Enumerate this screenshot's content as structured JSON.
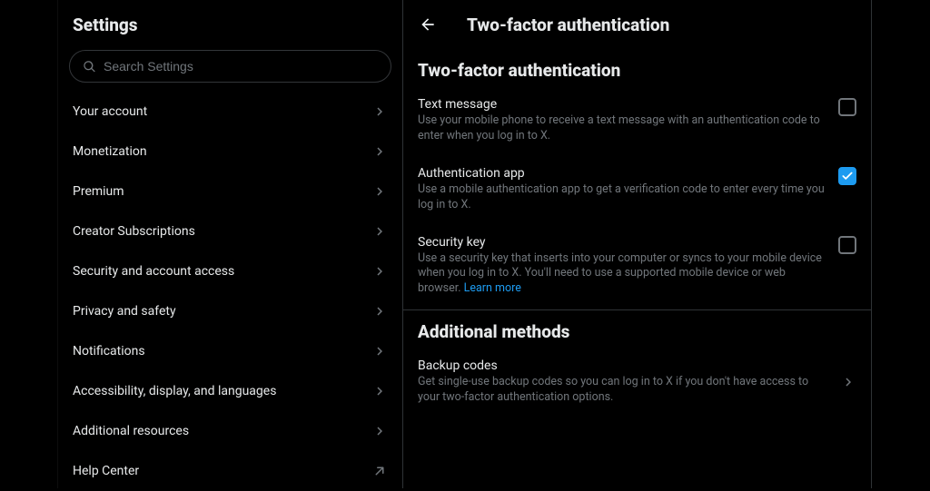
{
  "settings": {
    "title": "Settings",
    "search_placeholder": "Search Settings",
    "nav": [
      {
        "label": "Your account",
        "external": false
      },
      {
        "label": "Monetization",
        "external": false
      },
      {
        "label": "Premium",
        "external": false
      },
      {
        "label": "Creator Subscriptions",
        "external": false
      },
      {
        "label": "Security and account access",
        "external": false
      },
      {
        "label": "Privacy and safety",
        "external": false
      },
      {
        "label": "Notifications",
        "external": false
      },
      {
        "label": "Accessibility, display, and languages",
        "external": false
      },
      {
        "label": "Additional resources",
        "external": false
      },
      {
        "label": "Help Center",
        "external": true
      }
    ]
  },
  "detail": {
    "header_title": "Two-factor authentication",
    "section_heading": "Two-factor authentication",
    "methods": [
      {
        "title": "Text message",
        "desc": "Use your mobile phone to receive a text message with an authentication code to enter when you log in to X.",
        "checked": false
      },
      {
        "title": "Authentication app",
        "desc": "Use a mobile authentication app to get a verification code to enter every time you log in to X.",
        "checked": true
      },
      {
        "title": "Security key",
        "desc": "Use a security key that inserts into your computer or syncs to your mobile device when you log in to X. You'll need to use a supported mobile device or web browser. ",
        "link_text": "Learn more",
        "checked": false
      }
    ],
    "additional_heading": "Additional methods",
    "backup": {
      "title": "Backup codes",
      "desc": "Get single-use backup codes so you can log in to X if you don't have access to your two-factor authentication options."
    }
  }
}
